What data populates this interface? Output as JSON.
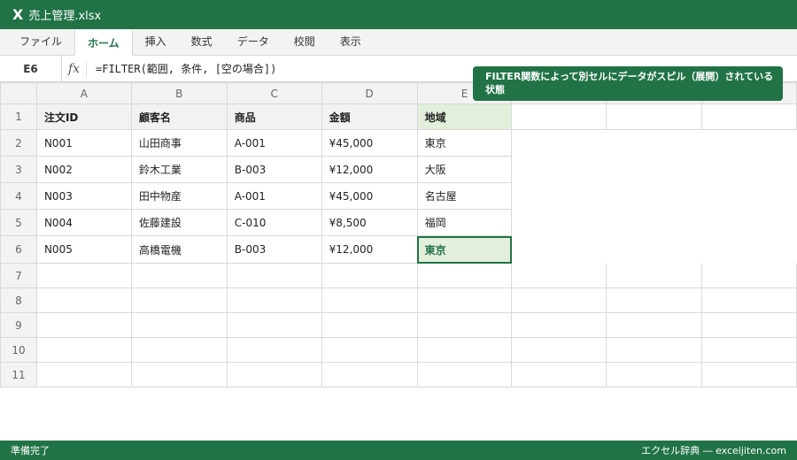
{
  "window": {
    "app_icon": "X",
    "title": "売上管理.xlsx"
  },
  "ribbon": {
    "tabs": [
      {
        "label": "ファイル",
        "active": false
      },
      {
        "label": "ホーム",
        "active": true
      },
      {
        "label": "挿入",
        "active": false
      },
      {
        "label": "数式",
        "active": false
      },
      {
        "label": "データ",
        "active": false
      },
      {
        "label": "校閲",
        "active": false
      },
      {
        "label": "表示",
        "active": false
      }
    ]
  },
  "formula_bar": {
    "cell_ref": "E6",
    "fx_label": "fx",
    "formula": "=FILTER(範囲, 条件, [空の場合])"
  },
  "grid": {
    "columns": [
      "A",
      "B",
      "C",
      "D",
      "E",
      "",
      "",
      ""
    ],
    "rows": [
      "1",
      "2",
      "3",
      "4",
      "5",
      "6",
      "7",
      "8",
      "9",
      "10",
      "11"
    ],
    "header_row": [
      "注文ID",
      "顧客名",
      "商品",
      "金額",
      "地域"
    ],
    "data_rows": [
      [
        "N001",
        "山田商事",
        "A-001",
        "¥45,000",
        "東京"
      ],
      [
        "N002",
        "鈴木工業",
        "B-003",
        "¥12,000",
        "大阪"
      ],
      [
        "N003",
        "田中物産",
        "A-001",
        "¥45,000",
        "名古屋"
      ],
      [
        "N004",
        "佐藤建設",
        "C-010",
        "¥8,500",
        "福岡"
      ],
      [
        "N005",
        "高橋電機",
        "B-003",
        "¥12,000",
        "東京"
      ]
    ],
    "selected_cell": "E6"
  },
  "tooltip": {
    "text": "FILTER関数によって別セルにデータがスピル（展開）されている状態"
  },
  "status_bar": {
    "left": "準備完了",
    "right": "エクセル辞典 ― exceljiten.com"
  },
  "colors": {
    "accent": "#217346",
    "spill_fill": "#e2efda",
    "header_fill": "#f3f3f3"
  }
}
